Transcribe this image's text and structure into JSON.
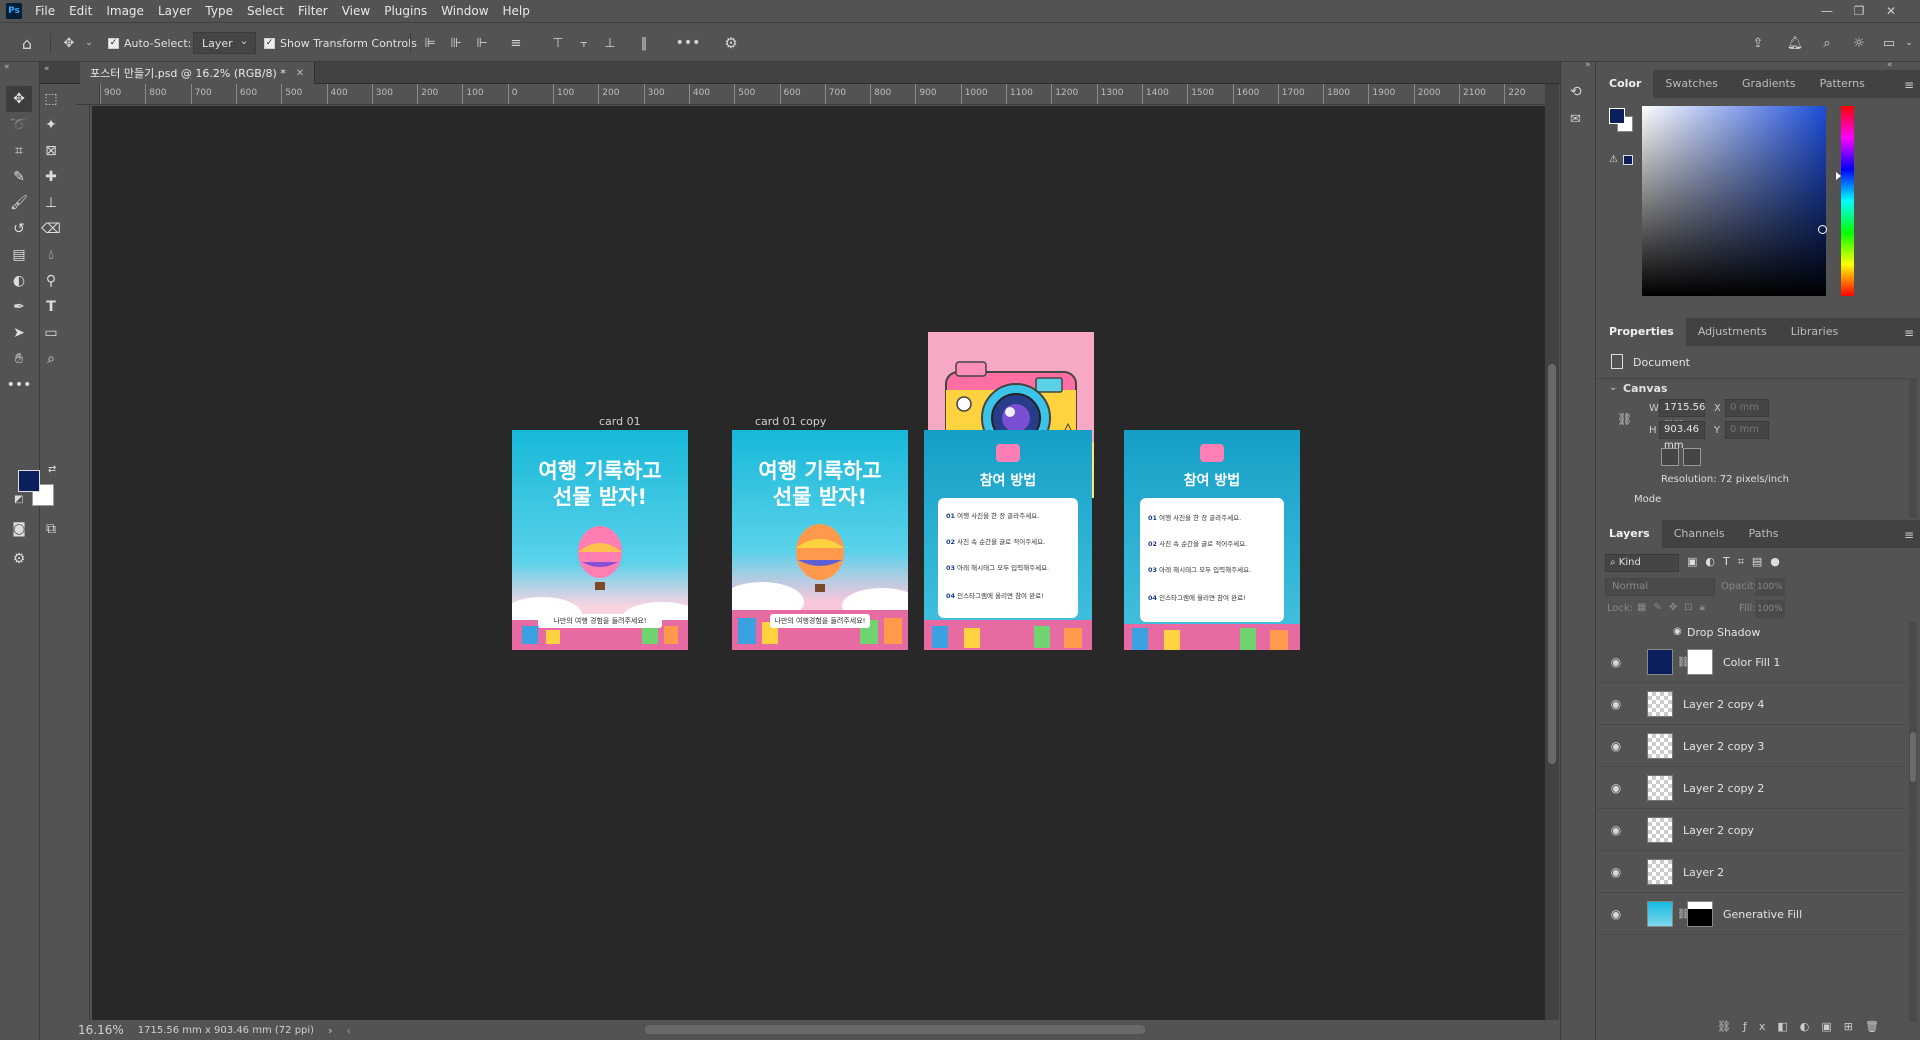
{
  "app": {
    "menu": [
      "File",
      "Edit",
      "Image",
      "Layer",
      "Type",
      "Select",
      "Filter",
      "View",
      "Plugins",
      "Window",
      "Help"
    ]
  },
  "options": {
    "auto_select_label": "Auto-Select:",
    "auto_select_value": "Layer",
    "show_transform_label": "Show Transform Controls"
  },
  "document": {
    "tab_title": "포스터 만들기.psd @ 16.2% (RGB/8) *",
    "zoom": "16.16%",
    "status_info": "1715.56 mm x 903.46 mm (72 ppi)"
  },
  "ruler": {
    "top_labels": [
      "900",
      "800",
      "700",
      "600",
      "500",
      "400",
      "300",
      "200",
      "100",
      "0",
      "100",
      "200",
      "300",
      "400",
      "500",
      "600",
      "700",
      "800",
      "900",
      "1000",
      "1100",
      "1200",
      "1300",
      "1400",
      "1500",
      "1600",
      "1700",
      "1800",
      "1900",
      "2000",
      "2100",
      "220"
    ]
  },
  "artboards": {
    "card1_label": "card 01",
    "card2_label": "card 01 copy",
    "headline_line1": "여행 기록하고",
    "headline_line2": "선물 받자!",
    "footer_text1": "나만의 여행 경험을 들려주세요!",
    "footer_text2": "나만의 여행경험을 들려주세요!",
    "how_title": "참여 방법",
    "steps": [
      {
        "num": "01",
        "text": "여행 사진을 한 장 골라주세요."
      },
      {
        "num": "02",
        "text": "사진 속 순간을 글로 적어주세요."
      },
      {
        "num": "03",
        "text": "아래 해시태그 모두 입력해주세요."
      },
      {
        "num": "04",
        "text": "인스타그램에 올리면 참여 완료!"
      }
    ]
  },
  "color_panel": {
    "tabs": [
      "Color",
      "Swatches",
      "Gradients",
      "Patterns"
    ],
    "foreground": "#0a1f5c",
    "background": "#ffffff"
  },
  "properties_panel": {
    "tabs": [
      "Properties",
      "Adjustments",
      "Libraries"
    ],
    "doc_label": "Document",
    "section": "Canvas",
    "w_label": "W",
    "w_value": "1715.56 mm",
    "h_label": "H",
    "h_value": "903.46 mm",
    "x_label": "X",
    "y_label": "Y",
    "x_placeholder": "0 mm",
    "y_placeholder": "0 mm",
    "resolution": "Resolution: 72 pixels/inch",
    "mode_label": "Mode"
  },
  "layers_panel": {
    "tabs": [
      "Layers",
      "Channels",
      "Paths"
    ],
    "filter_kind": "Kind",
    "blend_mode": "Normal",
    "opacity_label": "Opacity:",
    "opacity_value": "100%",
    "lock_label": "Lock:",
    "fill_label": "Fill:",
    "fill_value": "100%",
    "effect": "Drop Shadow",
    "layers": [
      {
        "name": "Color Fill 1"
      },
      {
        "name": "Layer 2 copy 4"
      },
      {
        "name": "Layer 2 copy 3"
      },
      {
        "name": "Layer 2 copy 2"
      },
      {
        "name": "Layer 2 copy"
      },
      {
        "name": "Layer 2"
      },
      {
        "name": "Generative Fill"
      }
    ]
  }
}
